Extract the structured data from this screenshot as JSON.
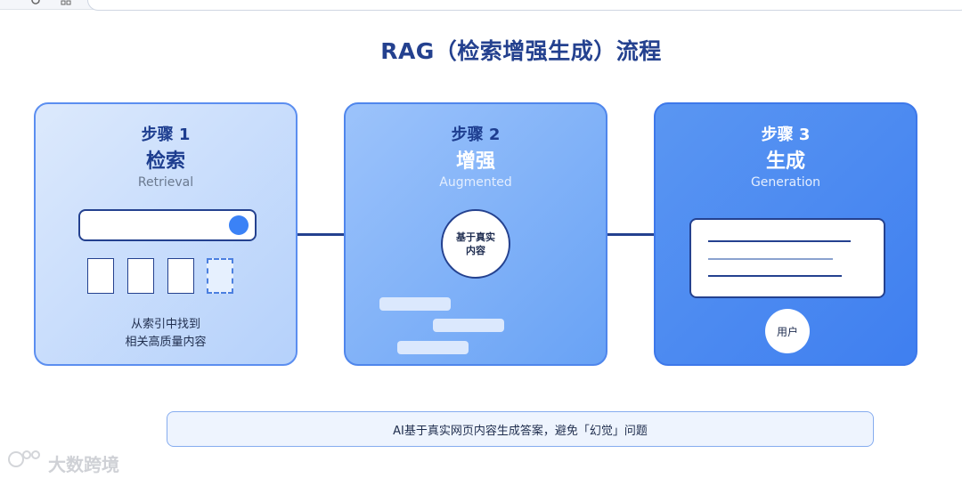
{
  "diagram": {
    "title": "RAG（检索增强生成）流程",
    "steps": [
      {
        "step_label": "步骤 1",
        "name": "检索",
        "subtitle": "Retrieval",
        "description_lines": [
          "从索引中找到",
          "相关高质量内容"
        ]
      },
      {
        "step_label": "步骤 2",
        "name": "增强",
        "subtitle": "Augmented",
        "circle_lines": [
          "基于真实",
          "内容"
        ]
      },
      {
        "step_label": "步骤 3",
        "name": "生成",
        "subtitle": "Generation",
        "user_label": "用户"
      }
    ],
    "note": "AI基于真实网页内容生成答案，避免「幻觉」问题"
  },
  "watermark": {
    "text": "大数跨境"
  },
  "colors": {
    "title": "#24418f",
    "card1": "#b5d1fb",
    "card2": "#68a2f5",
    "card3": "#3f7ff0",
    "accent": "#3b82f6"
  }
}
